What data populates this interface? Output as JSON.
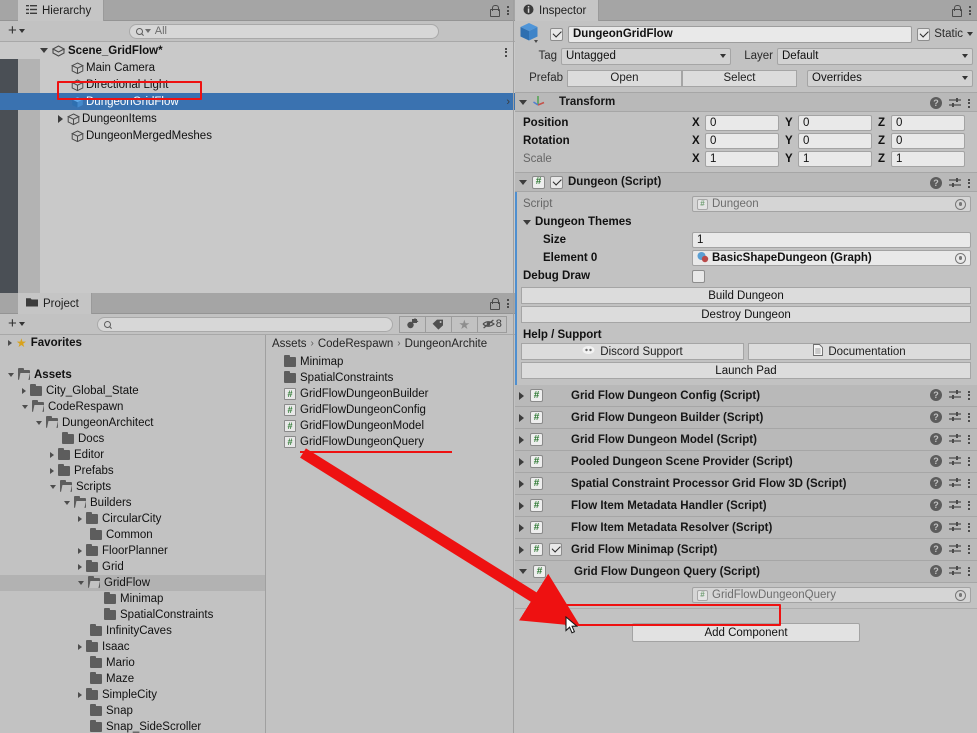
{
  "hierarchy": {
    "tab_label": "Hierarchy",
    "tab_icon": "hierarchy-icon",
    "search_placeholder": "All",
    "create_label": "+",
    "rows": [
      {
        "label": "Scene_GridFlow*",
        "icon": "scene-icon",
        "depth": 0,
        "expanded": true,
        "bold": true,
        "selected": false
      },
      {
        "label": "Main Camera",
        "icon": "gameobject-cube-icon",
        "depth": 1,
        "expanded": null,
        "bold": false,
        "selected": false
      },
      {
        "label": "Directional Light",
        "icon": "gameobject-cube-icon",
        "depth": 1,
        "expanded": null,
        "bold": false,
        "selected": false
      },
      {
        "label": "DungeonGridFlow",
        "icon": "gameobject-cube-blue-icon",
        "depth": 1,
        "expanded": null,
        "bold": false,
        "selected": true
      },
      {
        "label": "DungeonItems",
        "icon": "gameobject-cube-icon",
        "depth": 1,
        "expanded": false,
        "bold": false,
        "selected": false
      },
      {
        "label": "DungeonMergedMeshes",
        "icon": "gameobject-cube-icon",
        "depth": 1,
        "expanded": null,
        "bold": false,
        "selected": false
      }
    ]
  },
  "project": {
    "tab_label": "Project",
    "search_placeholder": "",
    "create_label": "+",
    "hidden_count": "8",
    "tree": [
      {
        "label": "Favorites",
        "depth": 0,
        "arrow": "right",
        "icon": "star-icon",
        "bold": true,
        "selected": false
      },
      {
        "label": "",
        "depth": 0,
        "arrow": "none",
        "icon": "none",
        "bold": false,
        "selected": false
      },
      {
        "label": "Assets",
        "depth": 0,
        "arrow": "down",
        "icon": "folder-open-icon",
        "bold": true,
        "selected": false
      },
      {
        "label": "City_Global_State",
        "depth": 1,
        "arrow": "right",
        "icon": "folder-icon",
        "bold": false,
        "selected": false
      },
      {
        "label": "CodeRespawn",
        "depth": 1,
        "arrow": "down",
        "icon": "folder-open-icon",
        "bold": false,
        "selected": false
      },
      {
        "label": "DungeonArchitect",
        "depth": 2,
        "arrow": "down",
        "icon": "folder-open-icon",
        "bold": false,
        "selected": false
      },
      {
        "label": "Docs",
        "depth": 3,
        "arrow": "none",
        "icon": "folder-icon",
        "bold": false,
        "selected": false
      },
      {
        "label": "Editor",
        "depth": 3,
        "arrow": "right",
        "icon": "folder-icon",
        "bold": false,
        "selected": false
      },
      {
        "label": "Prefabs",
        "depth": 3,
        "arrow": "right",
        "icon": "folder-icon",
        "bold": false,
        "selected": false
      },
      {
        "label": "Scripts",
        "depth": 3,
        "arrow": "down",
        "icon": "folder-open-icon",
        "bold": false,
        "selected": false
      },
      {
        "label": "Builders",
        "depth": 4,
        "arrow": "down",
        "icon": "folder-open-icon",
        "bold": false,
        "selected": false
      },
      {
        "label": "CircularCity",
        "depth": 5,
        "arrow": "right",
        "icon": "folder-icon",
        "bold": false,
        "selected": false
      },
      {
        "label": "Common",
        "depth": 5,
        "arrow": "none",
        "icon": "folder-icon",
        "bold": false,
        "selected": false
      },
      {
        "label": "FloorPlanner",
        "depth": 5,
        "arrow": "right",
        "icon": "folder-icon",
        "bold": false,
        "selected": false
      },
      {
        "label": "Grid",
        "depth": 5,
        "arrow": "right",
        "icon": "folder-icon",
        "bold": false,
        "selected": false
      },
      {
        "label": "GridFlow",
        "depth": 5,
        "arrow": "down",
        "icon": "folder-open-icon",
        "bold": false,
        "selected": true
      },
      {
        "label": "Minimap",
        "depth": 6,
        "arrow": "none",
        "icon": "folder-icon",
        "bold": false,
        "selected": false
      },
      {
        "label": "SpatialConstraints",
        "depth": 6,
        "arrow": "none",
        "icon": "folder-icon",
        "bold": false,
        "selected": false
      },
      {
        "label": "InfinityCaves",
        "depth": 5,
        "arrow": "none",
        "icon": "folder-icon",
        "bold": false,
        "selected": false
      },
      {
        "label": "Isaac",
        "depth": 5,
        "arrow": "right",
        "icon": "folder-icon",
        "bold": false,
        "selected": false
      },
      {
        "label": "Mario",
        "depth": 5,
        "arrow": "none",
        "icon": "folder-icon",
        "bold": false,
        "selected": false
      },
      {
        "label": "Maze",
        "depth": 5,
        "arrow": "none",
        "icon": "folder-icon",
        "bold": false,
        "selected": false
      },
      {
        "label": "SimpleCity",
        "depth": 5,
        "arrow": "right",
        "icon": "folder-icon",
        "bold": false,
        "selected": false
      },
      {
        "label": "Snap",
        "depth": 5,
        "arrow": "none",
        "icon": "folder-icon",
        "bold": false,
        "selected": false
      },
      {
        "label": "Snap_SideScroller",
        "depth": 5,
        "arrow": "none",
        "icon": "folder-icon",
        "bold": false,
        "selected": false
      }
    ],
    "breadcrumb": [
      "Assets",
      "CodeRespawn",
      "DungeonArchite"
    ],
    "contents": [
      {
        "label": "Minimap",
        "icon": "folder-icon",
        "underlined": false
      },
      {
        "label": "SpatialConstraints",
        "icon": "folder-icon",
        "underlined": false
      },
      {
        "label": "GridFlowDungeonBuilder",
        "icon": "csharp-script-icon",
        "underlined": false
      },
      {
        "label": "GridFlowDungeonConfig",
        "icon": "csharp-script-icon",
        "underlined": false
      },
      {
        "label": "GridFlowDungeonModel",
        "icon": "csharp-script-icon",
        "underlined": false
      },
      {
        "label": "GridFlowDungeonQuery",
        "icon": "csharp-script-icon",
        "underlined": true
      }
    ]
  },
  "inspector": {
    "tab_label": "Inspector",
    "gameobject": {
      "name": "DungeonGridFlow",
      "enabled": true,
      "static_label": "Static",
      "static_checked": true,
      "tag_label": "Tag",
      "tag_value": "Untagged",
      "layer_label": "Layer",
      "layer_value": "Default",
      "prefab_label": "Prefab",
      "prefab_open": "Open",
      "prefab_select": "Select",
      "prefab_overrides": "Overrides"
    },
    "transform": {
      "title": "Transform",
      "rows": [
        {
          "label": "Position",
          "dim": false,
          "x": "0",
          "y": "0",
          "z": "0"
        },
        {
          "label": "Rotation",
          "dim": false,
          "x": "0",
          "y": "0",
          "z": "0"
        },
        {
          "label": "Scale",
          "dim": true,
          "x": "1",
          "y": "1",
          "z": "1"
        }
      ],
      "axes": [
        "X",
        "Y",
        "Z"
      ]
    },
    "dungeon": {
      "title": "Dungeon (Script)",
      "enabled": true,
      "script_label": "Script",
      "script_value": "Dungeon",
      "themes_label": "Dungeon Themes",
      "size_label": "Size",
      "size_value": "1",
      "element0_label": "Element 0",
      "element0_value": "BasicShapeDungeon (Graph)",
      "debug_draw_label": "Debug Draw",
      "debug_draw_checked": false,
      "build_button": "Build Dungeon",
      "destroy_button": "Destroy Dungeon",
      "help_label": "Help / Support",
      "discord_button": "Discord Support",
      "documentation_button": "Documentation",
      "launchpad_button": "Launch Pad"
    },
    "components": [
      {
        "title": "Grid Flow Dungeon Config (Script)",
        "expanded": false,
        "has_enable_checkbox": false,
        "highlighted": false
      },
      {
        "title": "Grid Flow Dungeon Builder (Script)",
        "expanded": false,
        "has_enable_checkbox": false,
        "highlighted": false
      },
      {
        "title": "Grid Flow Dungeon Model (Script)",
        "expanded": false,
        "has_enable_checkbox": false,
        "highlighted": false
      },
      {
        "title": "Pooled Dungeon Scene Provider (Script)",
        "expanded": false,
        "has_enable_checkbox": false,
        "highlighted": false
      },
      {
        "title": "Spatial Constraint Processor Grid Flow 3D (Script)",
        "expanded": false,
        "has_enable_checkbox": false,
        "highlighted": false
      },
      {
        "title": "Flow Item Metadata Handler (Script)",
        "expanded": false,
        "has_enable_checkbox": false,
        "highlighted": false
      },
      {
        "title": "Flow Item Metadata Resolver (Script)",
        "expanded": false,
        "has_enable_checkbox": false,
        "highlighted": false
      },
      {
        "title": "Grid Flow Minimap (Script)",
        "expanded": false,
        "has_enable_checkbox": true,
        "highlighted": false
      },
      {
        "title": "Grid Flow Dungeon Query (Script)",
        "expanded": true,
        "has_enable_checkbox": false,
        "highlighted": true
      }
    ],
    "query_script_label": "Script",
    "query_script_value": "GridFlowDungeonQuery",
    "add_component_button": "Add Component"
  },
  "annotations": {
    "highlight_color": "#ee1111",
    "boxes": [
      {
        "name": "hierarchy-dungeongridflow-highlight"
      },
      {
        "name": "grid-flow-dungeon-query-component-highlight"
      }
    ],
    "arrow": {
      "from": "GridFlowDungeonQuery asset in Project",
      "to": "Grid Flow Dungeon Query (Script) component in Inspector"
    }
  }
}
